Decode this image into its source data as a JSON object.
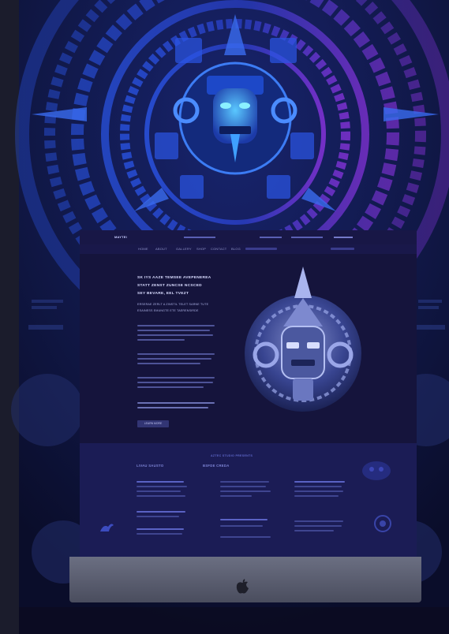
{
  "site": {
    "logo": "MAYTEI",
    "nav_items": [
      "HOME",
      "ABOUT",
      "GALLERY",
      "SHOP",
      "CONTACT",
      "BLOG"
    ],
    "hero_title_lines": [
      "SK IYS AAZE TEMSEE AVEPENEREA",
      "STATT ZENST ZUNCSE NCSCED",
      "SEY BEVARE, EEL TVEZT"
    ],
    "hero_subtitle_lines": [
      "ERSERAE ZERLT A ZINSTIL TELET SARNE TUTE",
      "ESAINESS EMUNGTE ETE TAERENSIRDE"
    ],
    "hero_button": "LEARN MORE",
    "footer_heading_left": "LIVAU SAUSTO",
    "footer_heading_mid": "BSFDE CREDA",
    "footer_banner": "AZTEC STUDIO PRESENTS"
  },
  "colors": {
    "screen_bg": "#141339",
    "footer_bg": "#1b1c55",
    "accent_blue": "#2b4fd6",
    "accent_purple": "#8a2fd6"
  },
  "icons": [
    "aztec-sun-stone-icon",
    "aztec-mask-icon",
    "apple-logo-icon",
    "bird-glyph-icon"
  ]
}
